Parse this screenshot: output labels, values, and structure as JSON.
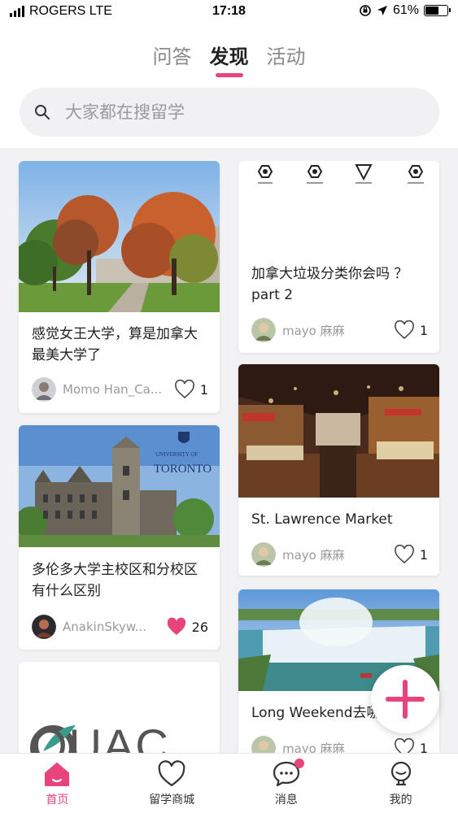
{
  "status_bar": {
    "carrier": "ROGERS LTE",
    "time": "17:18",
    "battery": "61%"
  },
  "tabs": [
    {
      "label": "问答",
      "active": false
    },
    {
      "label": "发现",
      "active": true
    },
    {
      "label": "活动",
      "active": false
    }
  ],
  "search": {
    "placeholder": "大家都在搜留学"
  },
  "cards": [
    {
      "title": "感觉女王大学，算是加拿大最美大学了",
      "author": "Momo Han_Ca...",
      "likes": "1",
      "liked": false
    },
    {
      "title": "加拿大垃圾分类你会吗 ？part 2",
      "author": "mayo 麻麻",
      "likes": "1",
      "liked": false
    },
    {
      "title": "多伦多大学主校区和分校区有什么区别",
      "author": "AnakinSkyw...",
      "likes": "26",
      "liked": true
    },
    {
      "title": "St. Lawrence Market",
      "author": "mayo 麻麻",
      "likes": "1",
      "liked": false
    },
    {
      "title": "Long Weekend去哪里？",
      "author": "mayo 麻麻",
      "likes": "1",
      "liked": false
    }
  ],
  "images": {
    "uoft_university_of": "UNIVERSITY OF",
    "uoft_toronto": "TORONTO",
    "ouac_logo": "OUAC"
  },
  "bottom_nav": [
    {
      "label": "首页",
      "icon": "home-icon",
      "active": true
    },
    {
      "label": "留学商城",
      "icon": "heart-shop-icon",
      "active": false
    },
    {
      "label": "消息",
      "icon": "message-icon",
      "active": false
    },
    {
      "label": "我的",
      "icon": "profile-icon",
      "active": false
    }
  ],
  "colors": {
    "accent": "#e8437a"
  }
}
